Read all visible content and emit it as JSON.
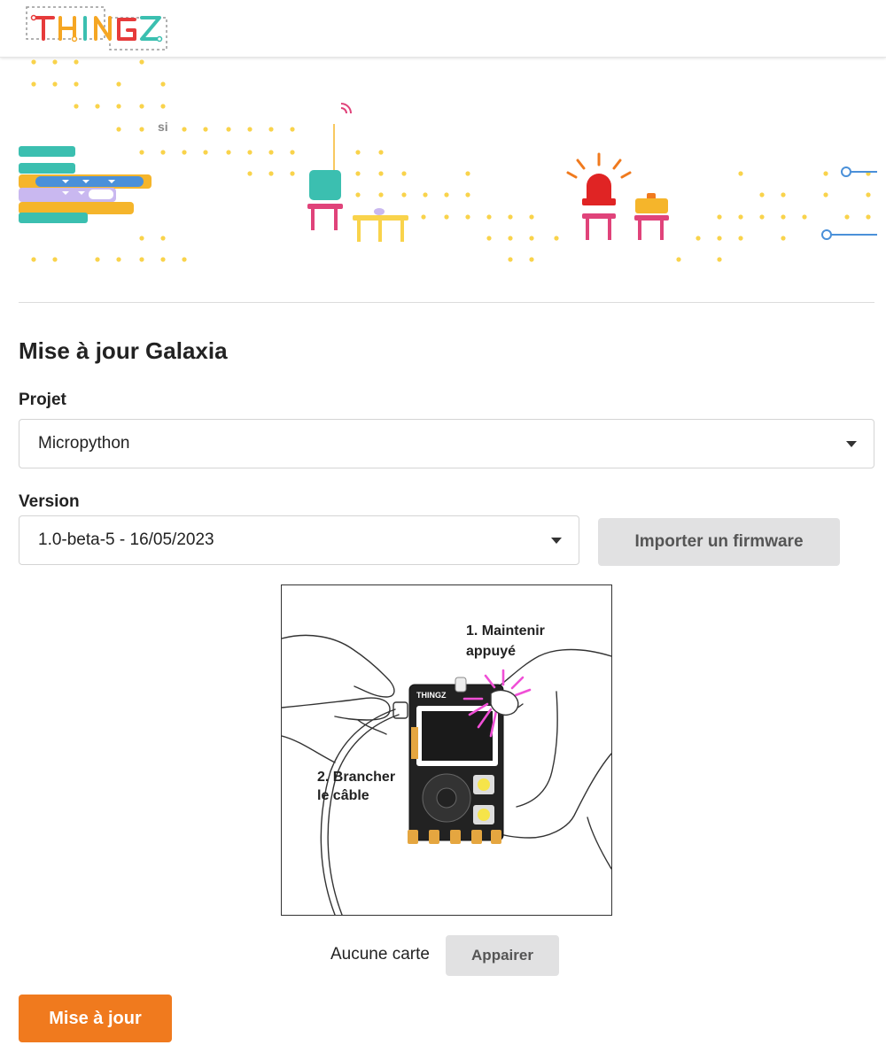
{
  "header": {
    "logo_text": "THINGZ"
  },
  "banner": {
    "code_text": "si"
  },
  "page": {
    "title": "Mise à jour Galaxia"
  },
  "form": {
    "project_label": "Projet",
    "project_value": "Micropython",
    "version_label": "Version",
    "version_value": "1.0-beta-5 - 16/05/2023",
    "import_button": "Importer un firmware"
  },
  "instructions": {
    "step1_line1": "1. Maintenir",
    "step1_line2": "appuyé",
    "step2_line1": "2. Brancher",
    "step2_line2": "le câble",
    "device_brand": "THINGZ"
  },
  "pairing": {
    "status": "Aucune carte",
    "pair_button": "Appairer"
  },
  "actions": {
    "update_button": "Mise à jour"
  },
  "colors": {
    "accent": "#f07a1e",
    "button_grey": "#e1e1e2"
  }
}
